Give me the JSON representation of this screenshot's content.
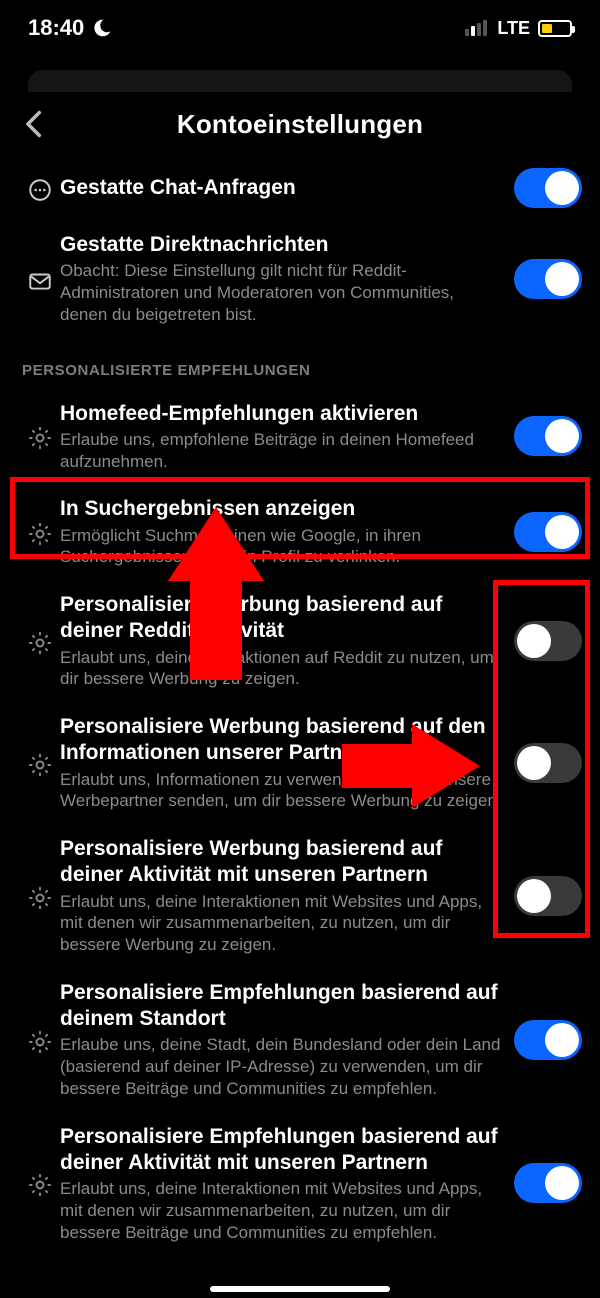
{
  "status": {
    "time": "18:40",
    "net": "LTE"
  },
  "header": {
    "title": "Kontoeinstellungen"
  },
  "rows": {
    "chat": {
      "title": "Gestatte Chat-Anfragen",
      "on": true
    },
    "dm": {
      "title": "Gestatte Direktnachrichten",
      "sub": "Obacht: Diese Einstellung gilt nicht für Reddit-Administratoren und Moderatoren von Communities, denen du beigetreten bist.",
      "on": true
    },
    "section_personal": "PERSONALISIERTE EMPFEHLUNGEN",
    "home": {
      "title": "Homefeed-Empfehlungen aktivieren",
      "sub": "Erlaube uns, empfohlene Beiträge in deinen Homefeed aufzunehmen.",
      "on": true
    },
    "search": {
      "title": "In Suchergebnissen anzeigen",
      "sub": "Ermöglicht Suchmaschinen wie Google, in ihren Suchergebnissen auf dein Profil zu verlinken.",
      "on": true
    },
    "ad1": {
      "title": "Personalisiere Werbung basierend auf deiner Reddit-Aktivität",
      "sub": "Erlaubt uns, deine Interaktionen auf Reddit zu nutzen, um dir bessere Werbung zu zeigen.",
      "on": false
    },
    "ad2": {
      "title": "Personalisiere Werbung basierend auf den Informationen unserer Partner",
      "sub": "Erlaubt uns, Informationen zu verwenden, die uns unsere Werbepartner senden, um dir bessere Werbung zu zeigen",
      "on": false
    },
    "ad3": {
      "title": "Personalisiere Werbung basierend auf deiner Aktivität mit unseren Partnern",
      "sub": "Erlaubt uns, deine Interaktionen mit Websites und Apps, mit denen wir zusammenarbeiten, zu nutzen, um dir bessere Werbung zu zeigen.",
      "on": false
    },
    "rec1": {
      "title": "Personalisiere Empfehlungen basierend auf deinem Standort",
      "sub": "Erlaube uns, deine Stadt, dein Bundesland oder dein Land (basierend auf deiner IP-Adresse) zu verwenden, um dir bessere Beiträge und Communities zu empfehlen.",
      "on": true
    },
    "rec2": {
      "title": "Personalisiere Empfehlungen basierend auf deiner Aktivität mit unseren Partnern",
      "sub": "Erlaubt uns, deine Interaktionen mit Websites und Apps, mit denen wir zusammenarbeiten, zu nutzen, um dir bessere Beiträge und Communities zu empfehlen.",
      "on": true
    }
  }
}
